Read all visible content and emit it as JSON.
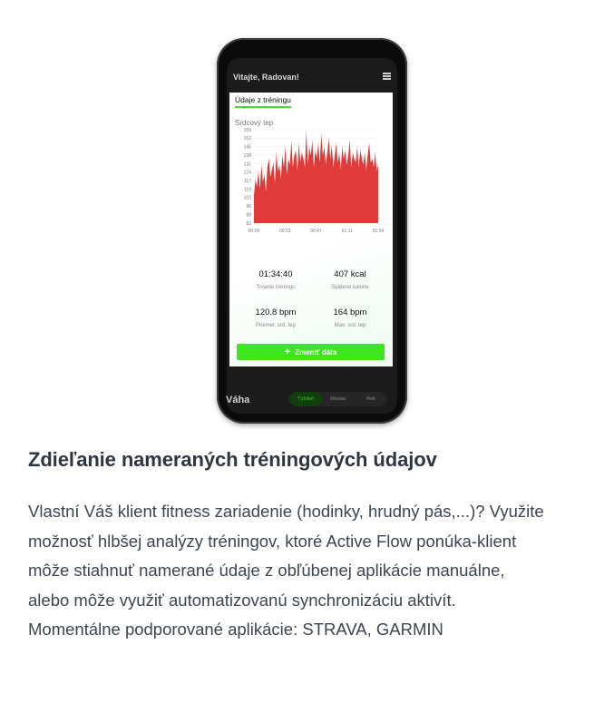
{
  "app": {
    "welcome": "Vitajte, Radovan!",
    "card_title": "Údaje z tréningu",
    "chart_title": "Srdcový tep",
    "stats": [
      {
        "value": "01:34:40",
        "label": "Trvanie tréningu"
      },
      {
        "value": "407 kcal",
        "label": "Spálené kalórie"
      },
      {
        "value": "120.8 bpm",
        "label": "Priemer. srd. tep"
      },
      {
        "value": "164 bpm",
        "label": "Max. srd. tep"
      }
    ],
    "change_button": "Zmeniť dáta",
    "weight_label": "Váha",
    "segments": [
      "Týždeň",
      "Mesiac",
      "Rok"
    ],
    "active_segment": "Týždeň",
    "accent_color": "#3ee61f",
    "chart_color": "#e03b3b"
  },
  "chart_data": {
    "type": "area",
    "title": "Srdcový tep",
    "y_ticks": [
      "159",
      "152",
      "145",
      "138",
      "131",
      "124",
      "117",
      "110",
      "103",
      "96",
      "89",
      "82"
    ],
    "x_ticks": [
      "00:00",
      "00:23",
      "00:47",
      "01:11",
      "01:34"
    ],
    "ylim": [
      82,
      159
    ],
    "grid": true,
    "values": [
      105,
      118,
      112,
      125,
      110,
      130,
      116,
      122,
      108,
      128,
      135,
      120,
      126,
      132,
      115,
      140,
      125,
      130,
      118,
      138,
      128,
      145,
      122,
      135,
      130,
      150,
      128,
      138,
      142,
      125,
      148,
      132,
      140,
      135,
      128,
      158,
      130,
      145,
      138,
      150,
      128,
      142,
      136,
      148,
      132,
      155,
      138,
      145,
      130,
      140,
      152,
      135,
      146,
      128,
      138,
      148,
      132,
      140,
      126,
      145,
      135,
      142,
      130,
      138,
      150,
      128,
      140,
      135,
      132,
      145,
      128,
      142,
      136,
      130,
      140,
      125,
      138,
      148,
      132,
      135,
      128,
      140,
      125,
      130
    ]
  },
  "article": {
    "heading": "Zdieľanie nameraných tréningových údajov",
    "lines": [
      "Vlastní Váš klient fitness zariadenie (hodinky, hrudný pás,...)? Využite",
      "možnosť hlbšej analýzy tréningov, ktoré Active Flow ponúka-klient",
      "môže stiahnuť namerané údaje z obľúbenej aplikácie manuálne,",
      "alebo môže využiť automatizovanú synchronizáciu aktivít.",
      "Momentálne podporované aplikácie: STRAVA, GARMIN"
    ]
  }
}
